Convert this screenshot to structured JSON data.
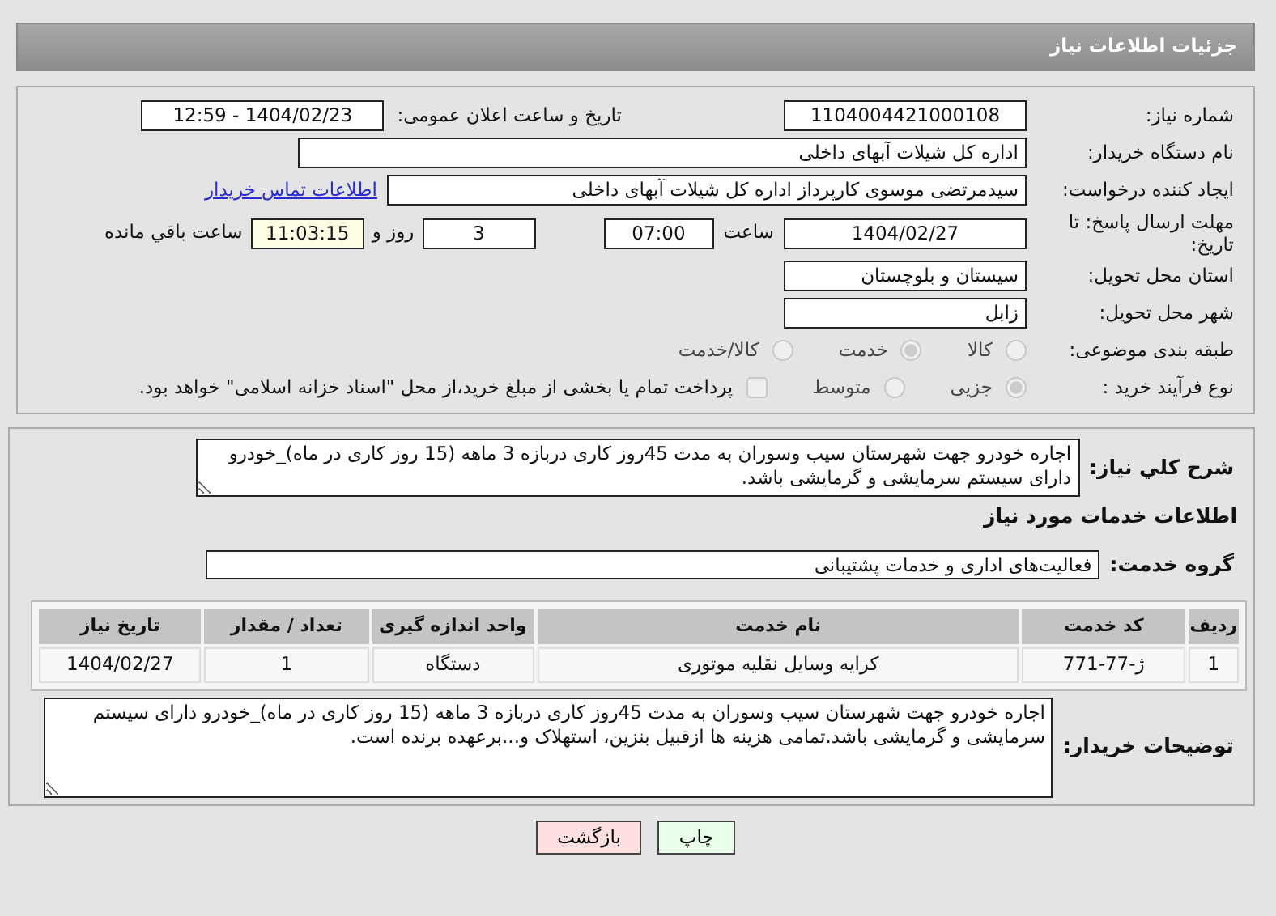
{
  "header": {
    "title": "جزئیات اطلاعات نیاز"
  },
  "need_number": {
    "label": "شماره نیاز:",
    "value": "1104004421000108"
  },
  "announce": {
    "label": "تاریخ و ساعت اعلان عمومی:",
    "value": "1404/02/23 - 12:59"
  },
  "buyer": {
    "label": "نام دستگاه خریدار:",
    "value": "اداره کل شیلات آبهای داخلی"
  },
  "creator": {
    "label": "ایجاد کننده درخواست:",
    "value": "سیدمرتضی موسوی کارپرداز اداره کل شیلات آبهای داخلی",
    "link": "اطلاعات تماس خریدار"
  },
  "deadline": {
    "label": "مهلت ارسال پاسخ: تا تاریخ:",
    "date": "1404/02/27",
    "time_label": "ساعت",
    "time": "07:00",
    "days": "3",
    "days_label": "روز و",
    "remaining": "11:03:15",
    "remaining_label": "ساعت باقي مانده"
  },
  "province": {
    "label": "استان محل تحویل:",
    "value": "سیستان و بلوچستان"
  },
  "city": {
    "label": "شهر محل تحویل:",
    "value": "زابل"
  },
  "category": {
    "label": "طبقه بندی موضوعی:",
    "options": [
      {
        "label": "کالا",
        "selected": false
      },
      {
        "label": "خدمت",
        "selected": true
      },
      {
        "label": "کالا/خدمت",
        "selected": false
      }
    ]
  },
  "process": {
    "label": "نوع فرآیند خرید :",
    "options": [
      {
        "label": "جزیی",
        "selected": true
      },
      {
        "label": "متوسط",
        "selected": false
      }
    ],
    "treasury": {
      "checked": false,
      "text": "پرداخت تمام یا بخشی از مبلغ خرید،از محل \"اسناد خزانه اسلامی\" خواهد بود."
    }
  },
  "description": {
    "label": "شرح کلي نياز:",
    "value": "اجاره خودرو جهت شهرستان سیب وسوران به مدت 45روز کاری دربازه 3 ماهه (15 روز کاری در ماه)_خودرو دارای سیستم سرمایشی و گرمایشی باشد."
  },
  "services_heading": "اطلاعات خدمات مورد نیاز",
  "service_group": {
    "label": "گروه خدمت:",
    "value": "فعالیت‌های اداری و خدمات پشتیبانی"
  },
  "table": {
    "columns": [
      "ردیف",
      "کد خدمت",
      "نام خدمت",
      "واحد اندازه گیری",
      "تعداد / مقدار",
      "تاریخ نیاز"
    ],
    "rows": [
      [
        "1",
        "ژ-77-771",
        "کرایه وسایل نقلیه موتوری",
        "دستگاه",
        "1",
        "1404/02/27"
      ]
    ]
  },
  "buyer_notes": {
    "label": "توضیحات خریدار:",
    "value": "اجاره خودرو جهت شهرستان سیب وسوران به مدت 45روز کاری دربازه 3 ماهه (15 روز کاری در ماه)_خودرو دارای سیستم سرمایشی و گرمایشی باشد.تمامی هزینه ها ازقبیل بنزین، استهلاک و...برعهده برنده است."
  },
  "buttons": [
    {
      "kind": "print",
      "label": "چاپ"
    },
    {
      "kind": "back",
      "label": "بازگشت"
    }
  ]
}
